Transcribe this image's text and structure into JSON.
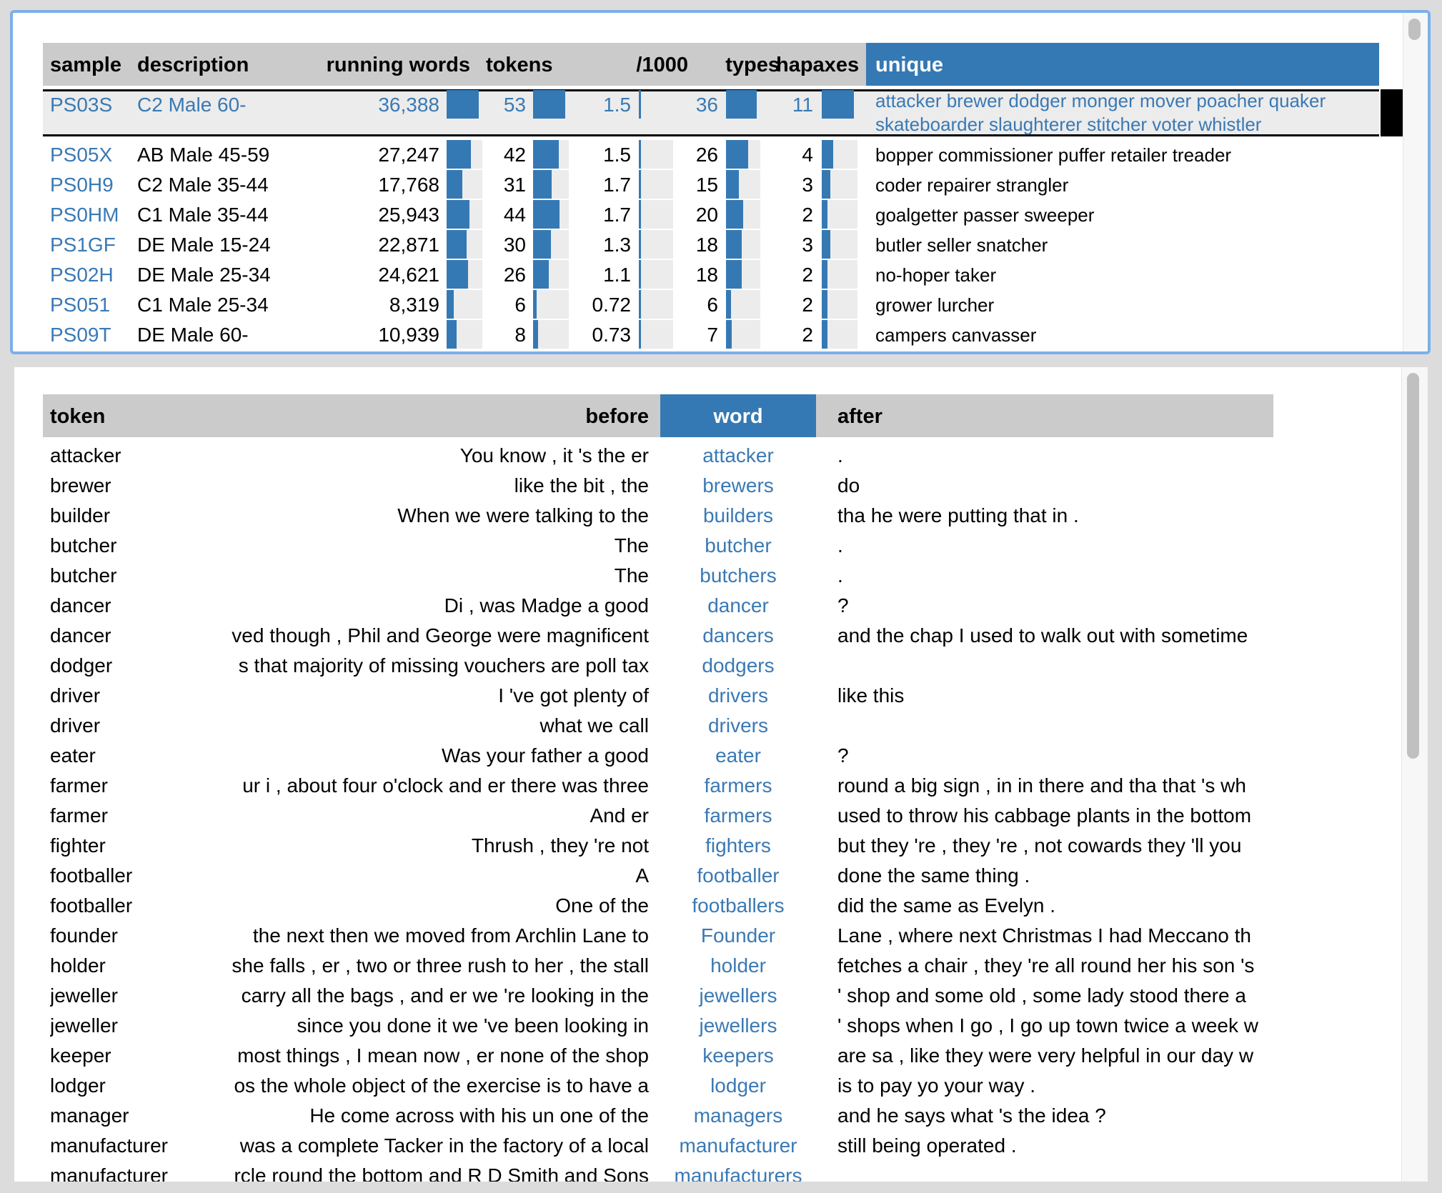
{
  "colors": {
    "accent": "#3579b4",
    "header_gray": "#cbcbcb",
    "selected_row": "#ececec",
    "focus_border": "#7ab0ea"
  },
  "samples_table": {
    "columns": [
      "sample",
      "description",
      "running words",
      "tokens",
      "/1000",
      "types",
      "hapaxes",
      "unique"
    ],
    "sorted_column": "unique",
    "bar_max": {
      "running_words": 36388,
      "tokens": 53,
      "per1000": 1.7,
      "types": 36,
      "hapaxes": 11
    },
    "rows": [
      {
        "sample": "PS03S",
        "description": "C2 Male 60-",
        "running_words": "36,388",
        "running_words_value": 36388,
        "tokens": "53",
        "tokens_value": 53,
        "per1000": "1.5",
        "per1000_value": 1.5,
        "types": "36",
        "types_value": 36,
        "hapaxes": "11",
        "hapaxes_value": 11,
        "unique": "attacker brewer dodger monger mover poacher quaker skateboarder slaughterer stitcher voter whistler",
        "selected": true
      },
      {
        "sample": "PS05X",
        "description": "AB Male 45-59",
        "running_words": "27,247",
        "running_words_value": 27247,
        "tokens": "42",
        "tokens_value": 42,
        "per1000": "1.5",
        "per1000_value": 1.5,
        "types": "26",
        "types_value": 26,
        "hapaxes": "4",
        "hapaxes_value": 4,
        "unique": "bopper commissioner puffer retailer treader"
      },
      {
        "sample": "PS0H9",
        "description": "C2 Male 35-44",
        "running_words": "17,768",
        "running_words_value": 17768,
        "tokens": "31",
        "tokens_value": 31,
        "per1000": "1.7",
        "per1000_value": 1.7,
        "types": "15",
        "types_value": 15,
        "hapaxes": "3",
        "hapaxes_value": 3,
        "unique": "coder repairer strangler"
      },
      {
        "sample": "PS0HM",
        "description": "C1 Male 35-44",
        "running_words": "25,943",
        "running_words_value": 25943,
        "tokens": "44",
        "tokens_value": 44,
        "per1000": "1.7",
        "per1000_value": 1.7,
        "types": "20",
        "types_value": 20,
        "hapaxes": "2",
        "hapaxes_value": 2,
        "unique": "goalgetter passer sweeper"
      },
      {
        "sample": "PS1GF",
        "description": "DE Male 15-24",
        "running_words": "22,871",
        "running_words_value": 22871,
        "tokens": "30",
        "tokens_value": 30,
        "per1000": "1.3",
        "per1000_value": 1.3,
        "types": "18",
        "types_value": 18,
        "hapaxes": "3",
        "hapaxes_value": 3,
        "unique": "butler seller snatcher"
      },
      {
        "sample": "PS02H",
        "description": "DE Male 25-34",
        "running_words": "24,621",
        "running_words_value": 24621,
        "tokens": "26",
        "tokens_value": 26,
        "per1000": "1.1",
        "per1000_value": 1.1,
        "types": "18",
        "types_value": 18,
        "hapaxes": "2",
        "hapaxes_value": 2,
        "unique": "no-hoper taker"
      },
      {
        "sample": "PS051",
        "description": "C1 Male 25-34",
        "running_words": "8,319",
        "running_words_value": 8319,
        "tokens": "6",
        "tokens_value": 6,
        "per1000": "0.72",
        "per1000_value": 0.72,
        "types": "6",
        "types_value": 6,
        "hapaxes": "2",
        "hapaxes_value": 2,
        "unique": "grower lurcher"
      },
      {
        "sample": "PS09T",
        "description": "DE Male 60-",
        "running_words": "10,939",
        "running_words_value": 10939,
        "tokens": "8",
        "tokens_value": 8,
        "per1000": "0.73",
        "per1000_value": 0.73,
        "types": "7",
        "types_value": 7,
        "hapaxes": "2",
        "hapaxes_value": 2,
        "unique": "campers canvasser"
      }
    ]
  },
  "concordance_table": {
    "columns": [
      "token",
      "before",
      "word",
      "after"
    ],
    "sorted_column": "word",
    "rows": [
      {
        "token": "attacker",
        "before": "You know , it 's the er",
        "word": "attacker",
        "after": "."
      },
      {
        "token": "brewer",
        "before": "like the bit , the",
        "word": "brewers",
        "after": "do"
      },
      {
        "token": "builder",
        "before": "When we were talking to the",
        "word": "builders",
        "after": "tha he were putting that in ."
      },
      {
        "token": "butcher",
        "before": "The",
        "word": "butcher",
        "after": "."
      },
      {
        "token": "butcher",
        "before": "The",
        "word": "butchers",
        "after": "."
      },
      {
        "token": "dancer",
        "before": "Di , was Madge a good",
        "word": "dancer",
        "after": "?"
      },
      {
        "token": "dancer",
        "before": "ved though , Phil and George were magnificent",
        "word": "dancers",
        "after": "and the chap I used to walk out with sometime"
      },
      {
        "token": "dodger",
        "before": "s that majority of missing vouchers are poll tax",
        "word": "dodgers",
        "after": ""
      },
      {
        "token": "driver",
        "before": "I 've got plenty of",
        "word": "drivers",
        "after": "like this"
      },
      {
        "token": "driver",
        "before": "what we call",
        "word": "drivers",
        "after": ""
      },
      {
        "token": "eater",
        "before": "Was your father a good",
        "word": "eater",
        "after": "?"
      },
      {
        "token": "farmer",
        "before": "ur i , about four o'clock and er there was three",
        "word": "farmers",
        "after": "round a big sign , in in there and tha that 's wh"
      },
      {
        "token": "farmer",
        "before": "And er",
        "word": "farmers",
        "after": "used to throw his cabbage plants in the bottom"
      },
      {
        "token": "fighter",
        "before": "Thrush , they 're not",
        "word": "fighters",
        "after": "but they 're , they 're , not cowards they 'll you"
      },
      {
        "token": "footballer",
        "before": "A",
        "word": "footballer",
        "after": "done the same thing ."
      },
      {
        "token": "footballer",
        "before": "One of the",
        "word": "footballers",
        "after": "did the same as Evelyn ."
      },
      {
        "token": "founder",
        "before": "the next then we moved from Archlin Lane to",
        "word": "Founder",
        "after": "Lane , where next Christmas I had Meccano th"
      },
      {
        "token": "holder",
        "before": "she falls , er , two or three rush to her , the stall",
        "word": "holder",
        "after": "fetches a chair , they 're all round her his son 's"
      },
      {
        "token": "jeweller",
        "before": "carry all the bags , and er we 're looking in the",
        "word": "jewellers",
        "after": "' shop and some old , some lady stood there a"
      },
      {
        "token": "jeweller",
        "before": "since you done it we 've been looking in",
        "word": "jewellers",
        "after": "' shops when I go , I go up town twice a week w"
      },
      {
        "token": "keeper",
        "before": "most things , I mean now , er none of the shop",
        "word": "keepers",
        "after": "are sa , like they were very helpful in our day w"
      },
      {
        "token": "lodger",
        "before": "os the whole object of the exercise is to have a",
        "word": "lodger",
        "after": "is to pay yo your way ."
      },
      {
        "token": "manager",
        "before": "He come across with his un one of the",
        "word": "managers",
        "after": "and he says what 's the idea ?"
      },
      {
        "token": "manufacturer",
        "before": "was a complete Tacker in the factory of a local",
        "word": "manufacturer",
        "after": "still being operated ."
      },
      {
        "token": "manufacturer",
        "before": "rcle round the bottom and R D Smith and Sons",
        "word": "manufacturers",
        "after": ""
      }
    ]
  }
}
